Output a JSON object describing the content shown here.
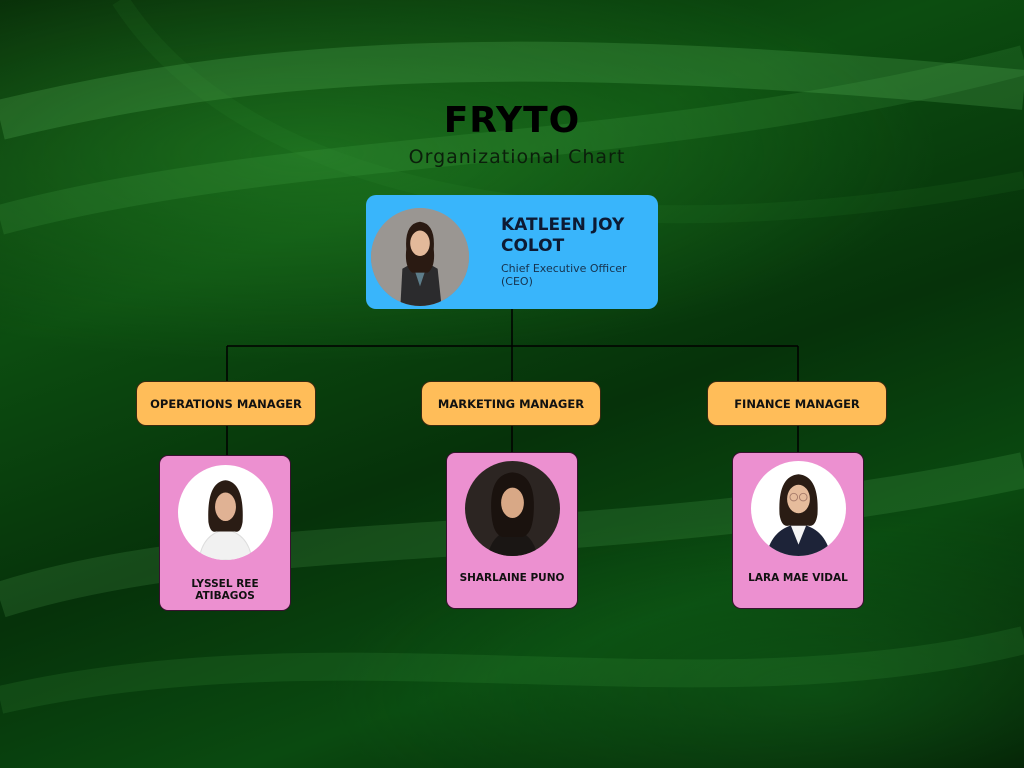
{
  "header": {
    "title": "FRYTO",
    "subtitle": "Organizational Chart"
  },
  "ceo": {
    "name": "KATLEEN JOY COLOT",
    "role": "Chief Executive Officer (CEO)"
  },
  "managers": [
    {
      "label": "OPERATIONS MANAGER",
      "employee": "LYSSEL REE ATIBAGOS"
    },
    {
      "label": "MARKETING MANAGER",
      "employee": "SHARLAINE PUNO"
    },
    {
      "label": "FINANCE MANAGER",
      "employee": "LARA MAE VIDAL"
    }
  ],
  "colors": {
    "ceo_box": "#39b5fb",
    "manager_box": "#ffbd59",
    "employee_box": "#ec90d0",
    "background": "#0c4d10"
  }
}
